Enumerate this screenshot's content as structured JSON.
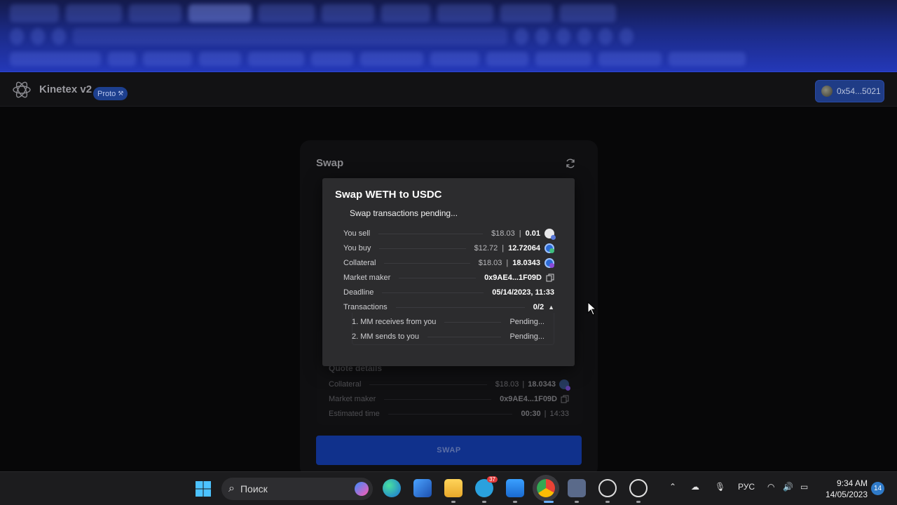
{
  "app": {
    "title": "Kinetex v2",
    "badge": "Proto",
    "wallet": "0x54...5021"
  },
  "swap_card": {
    "title": "Swap",
    "button": "SWAP",
    "quote_details": {
      "title": "Quote details",
      "rows": [
        {
          "label": "Collateral",
          "usd": "$18.03",
          "amount": "18.0343"
        },
        {
          "label": "Market maker",
          "value": "0x9AE4...1F09D"
        },
        {
          "label": "Estimated time",
          "value": "00:30",
          "value2": "14:33"
        }
      ]
    }
  },
  "modal": {
    "title": "Swap WETH to USDC",
    "status": "Swap transactions pending...",
    "rows": {
      "you_sell": {
        "label": "You sell",
        "usd": "$18.03",
        "amount": "0.01"
      },
      "you_buy": {
        "label": "You buy",
        "usd": "$12.72",
        "amount": "12.72064"
      },
      "collateral": {
        "label": "Collateral",
        "usd": "$18.03",
        "amount": "18.0343"
      },
      "market_maker": {
        "label": "Market maker",
        "value": "0x9AE4...1F09D"
      },
      "deadline": {
        "label": "Deadline",
        "value": "05/14/2023, 11:33"
      },
      "transactions": {
        "label": "Transactions",
        "value": "0/2"
      }
    },
    "transactions": [
      {
        "label": "1. MM receives from you",
        "status": "Pending..."
      },
      {
        "label": "2. MM sends to you",
        "status": "Pending..."
      }
    ],
    "separator": "|"
  },
  "taskbar": {
    "search_placeholder": "Поиск",
    "telegram_badge": "37",
    "language": "РУС",
    "time": "9:34 AM",
    "date": "14/05/2023",
    "notifications": "14"
  },
  "colors": {
    "accent": "#1f3c86",
    "swap_button": "#10318c",
    "modal_bg": "#2c2c2e"
  }
}
